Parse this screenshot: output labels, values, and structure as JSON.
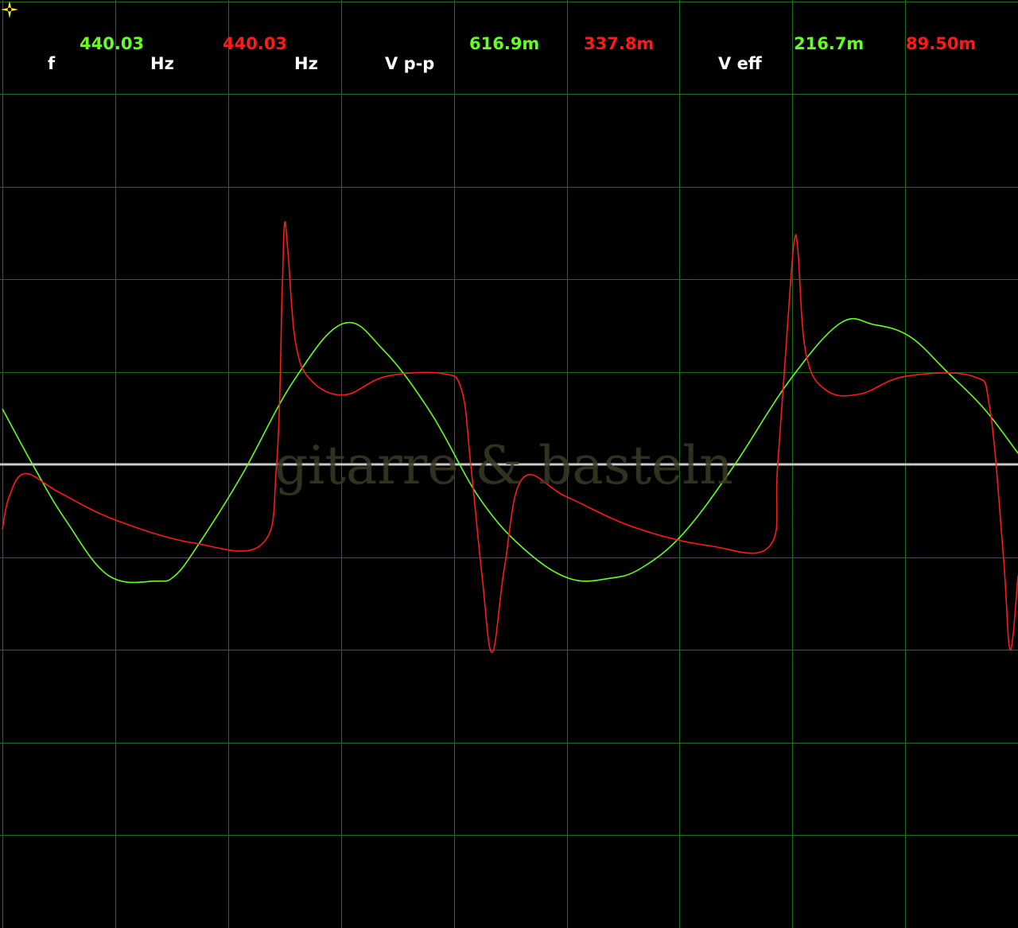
{
  "colors": {
    "background": "#000000",
    "grid": "#1f6b1f",
    "baseline": "#c8c8c8",
    "channel1": "#66ff22",
    "channel2": "#ff1a1a",
    "label": "#ffffff",
    "cursor": "#ffee00"
  },
  "readouts": {
    "frequency": {
      "label": "f",
      "ch1_value": "440.03",
      "ch1_unit": "Hz",
      "ch2_value": "440.03",
      "ch2_unit": "Hz"
    },
    "vpp": {
      "label": "V p-p",
      "ch1_value": "616.9m",
      "ch2_value": "337.8m"
    },
    "veff": {
      "label": "V eff",
      "ch1_value": "216.7m",
      "ch2_value": "89.50m"
    }
  },
  "watermark": "gitarre & basteln",
  "cursor_icon": "crosshair-cursor-icon",
  "chart_data": {
    "type": "line",
    "grid": true,
    "grid_divisions": {
      "x": 9,
      "y": 10
    },
    "ylim": [
      -5,
      5
    ],
    "xlim": [
      0,
      9
    ],
    "series": [
      {
        "x": [
          0,
          0.29,
          0.56,
          0.94,
          1.36,
          1.53,
          1.74,
          2.12,
          2.58,
          3.02,
          3.38,
          3.8,
          4.22,
          4.61,
          5.02,
          5.38,
          5.66,
          6.03,
          6.48,
          6.96,
          7.42,
          7.72,
          8.04,
          8.37,
          8.7,
          9.0
        ],
        "values": [
          0.6,
          -0.05,
          -0.6,
          -1.2,
          -1.26,
          -1.2,
          -0.86,
          -0.12,
          0.9,
          1.52,
          1.23,
          0.55,
          -0.35,
          -0.9,
          -1.23,
          -1.23,
          -1.12,
          -0.75,
          -0.02,
          0.88,
          1.52,
          1.51,
          1.38,
          1.0,
          0.6,
          0.12
        ]
      },
      {
        "x": [
          0,
          0.06,
          0.2,
          0.5,
          1.0,
          1.7,
          2.3,
          2.43,
          2.48,
          2.5,
          2.53,
          2.6,
          2.74,
          3.03,
          3.4,
          3.9,
          4.07,
          4.15,
          4.25,
          4.34,
          4.45,
          4.61,
          5.0,
          5.6,
          6.27,
          6.8,
          6.87,
          6.98,
          7.02,
          7.05,
          7.12,
          7.3,
          7.6,
          8.0,
          8.6,
          8.75,
          8.87,
          8.93,
          9.0
        ],
        "values": [
          -0.7,
          -0.35,
          -0.1,
          -0.3,
          -0.6,
          -0.85,
          -0.86,
          0.0,
          1.9,
          2.6,
          2.3,
          1.3,
          0.9,
          0.75,
          0.95,
          0.98,
          0.8,
          0.0,
          -1.2,
          -2.03,
          -1.1,
          -0.15,
          -0.35,
          -0.68,
          -0.88,
          -0.88,
          0.0,
          1.9,
          2.43,
          2.3,
          1.2,
          0.8,
          0.76,
          0.95,
          0.95,
          0.6,
          -1.0,
          -2.0,
          -1.2
        ]
      }
    ]
  }
}
